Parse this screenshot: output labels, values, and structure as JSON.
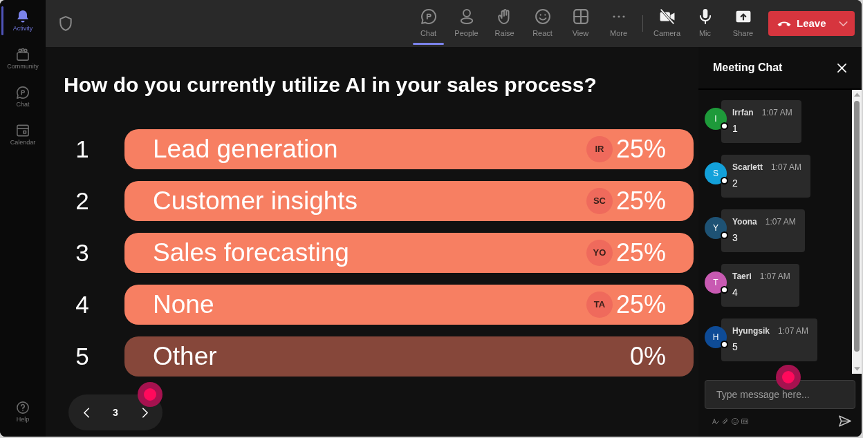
{
  "sidebar": {
    "items": [
      {
        "label": "Activity",
        "selected": true
      },
      {
        "label": "Community",
        "selected": false
      },
      {
        "label": "Chat",
        "selected": false
      },
      {
        "label": "Calendar",
        "selected": false
      }
    ],
    "help": {
      "label": "Help"
    }
  },
  "toolbar": {
    "items": [
      {
        "label": "Chat",
        "selected": true
      },
      {
        "label": "People",
        "selected": false
      },
      {
        "label": "Raise",
        "selected": false
      },
      {
        "label": "React",
        "selected": false
      },
      {
        "label": "View",
        "selected": false
      },
      {
        "label": "More",
        "selected": false
      }
    ],
    "devices": [
      {
        "label": "Camera",
        "on": false
      },
      {
        "label": "Mic",
        "on": true
      }
    ],
    "share_button": {
      "label": "Share"
    },
    "leave_button": {
      "label": "Leave"
    }
  },
  "poll": {
    "question": "How do you currently utilize AI in your sales process?",
    "options": [
      {
        "number": "1",
        "label": "Lead generation",
        "voters": [
          "IR"
        ],
        "percent": "25%",
        "dimmed": false
      },
      {
        "number": "2",
        "label": "Customer insights",
        "voters": [
          "SC"
        ],
        "percent": "25%",
        "dimmed": false
      },
      {
        "number": "3",
        "label": "Sales forecasting",
        "voters": [
          "YO"
        ],
        "percent": "25%",
        "dimmed": false
      },
      {
        "number": "4",
        "label": "None",
        "voters": [
          "TA"
        ],
        "percent": "25%",
        "dimmed": false
      },
      {
        "number": "5",
        "label": "Other",
        "percent": "0%",
        "dimmed": true
      }
    ],
    "pager": {
      "page": "3"
    }
  },
  "chat": {
    "title": "Meeting Chat",
    "messages": [
      {
        "initial": "I",
        "color": "#1e9a3a",
        "name": "Irrfan",
        "time": "1:07 AM",
        "text": "1"
      },
      {
        "initial": "S",
        "color": "#13a1da",
        "name": "Scarlett",
        "time": "1:07 AM",
        "text": "2"
      },
      {
        "initial": "Y",
        "color": "#1e5274",
        "name": "Yoona",
        "time": "1:07 AM",
        "text": "3"
      },
      {
        "initial": "T",
        "color": "#c85ab2",
        "name": "Taeri",
        "time": "1:07 AM",
        "text": "4"
      },
      {
        "initial": "H",
        "color": "#0e4b96",
        "name": "Hyungsik",
        "time": "1:07 AM",
        "text": "5"
      }
    ],
    "input": {
      "placeholder": "Type message here..."
    }
  }
}
